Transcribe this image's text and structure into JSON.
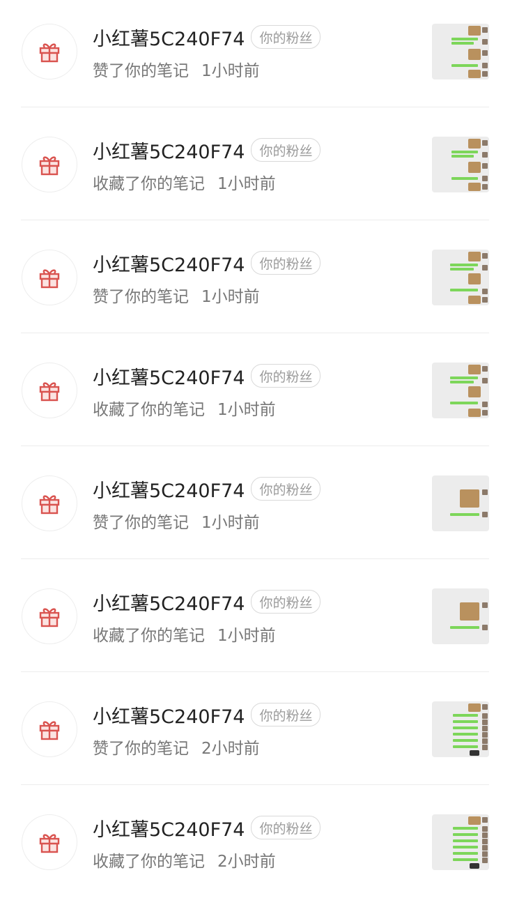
{
  "fan_badge": "你的粉丝",
  "items": [
    {
      "user": "小红薯5C240F74",
      "action": "赞了你的笔记",
      "time": "1小时前"
    },
    {
      "user": "小红薯5C240F74",
      "action": "收藏了你的笔记",
      "time": "1小时前"
    },
    {
      "user": "小红薯5C240F74",
      "action": "赞了你的笔记",
      "time": "1小时前"
    },
    {
      "user": "小红薯5C240F74",
      "action": "收藏了你的笔记",
      "time": "1小时前"
    },
    {
      "user": "小红薯5C240F74",
      "action": "赞了你的笔记",
      "time": "1小时前"
    },
    {
      "user": "小红薯5C240F74",
      "action": "收藏了你的笔记",
      "time": "1小时前"
    },
    {
      "user": "小红薯5C240F74",
      "action": "赞了你的笔记",
      "time": "2小时前"
    },
    {
      "user": "小红薯5C240F74",
      "action": "收藏了你的笔记",
      "time": "2小时前"
    }
  ],
  "icons": {
    "avatar": "gift-icon"
  },
  "colors": {
    "gift_stroke": "#d9534f",
    "gift_fill": "#fbe3e1",
    "chat_bubble": "#7dd65a"
  }
}
